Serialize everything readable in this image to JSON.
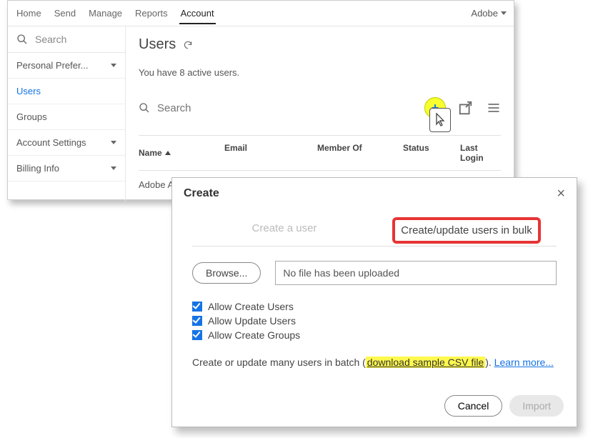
{
  "top_nav": {
    "tabs": [
      "Home",
      "Send",
      "Manage",
      "Reports",
      "Account"
    ],
    "active_index": 4,
    "account_label": "Adobe"
  },
  "sidebar": {
    "search_placeholder": "Search",
    "items": [
      {
        "label": "Personal Prefer...",
        "expandable": true
      },
      {
        "label": "Users",
        "expandable": false
      },
      {
        "label": "Groups",
        "expandable": false
      },
      {
        "label": "Account Settings",
        "expandable": true
      },
      {
        "label": "Billing Info",
        "expandable": true
      }
    ],
    "active_index": 1
  },
  "page": {
    "title": "Users",
    "subtitle": "You have 8 active users.",
    "search_placeholder": "Search"
  },
  "table": {
    "columns": [
      "Name",
      "Email",
      "Member Of",
      "Status",
      "Last Login"
    ],
    "sort_col": 0,
    "rows": [
      {
        "name": "Adobe A"
      }
    ]
  },
  "modal": {
    "title": "Create",
    "tab_single": "Create a user",
    "tab_bulk": "Create/update users in bulk",
    "browse_label": "Browse...",
    "file_status": "No file has been uploaded",
    "check_create_users": "Allow Create Users",
    "check_update_users": "Allow Update Users",
    "check_create_groups": "Allow Create Groups",
    "hint_prefix": "Create or update many users in batch (",
    "hint_link": "download sample CSV file",
    "hint_suffix": ").  ",
    "learn_more": "Learn more...",
    "cancel": "Cancel",
    "import": "Import"
  }
}
